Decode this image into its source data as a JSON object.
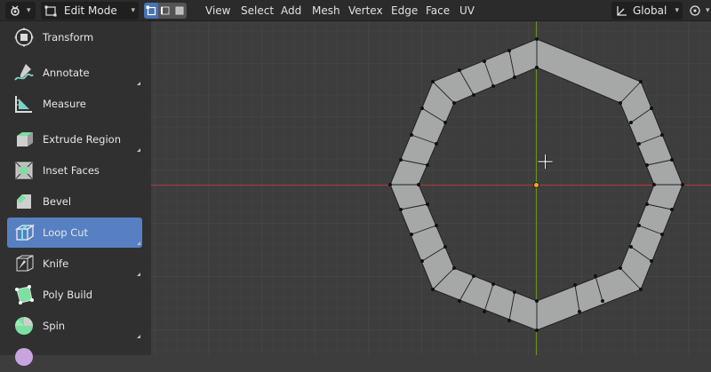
{
  "header": {
    "editor_type_icon": "editor-type-icon",
    "mode_label": "Edit Mode",
    "menus": [
      "View",
      "Select",
      "Add",
      "Mesh",
      "Vertex",
      "Edge",
      "Face",
      "UV"
    ],
    "transform_orientation": "Global"
  },
  "toolbar": {
    "tools": [
      {
        "label": "Transform",
        "icon": "transform-icon"
      },
      {
        "label": "Annotate",
        "icon": "annotate-icon"
      },
      {
        "label": "Measure",
        "icon": "measure-icon"
      },
      {
        "label": "Extrude Region",
        "icon": "extrude-icon"
      },
      {
        "label": "Inset Faces",
        "icon": "inset-icon"
      },
      {
        "label": "Bevel",
        "icon": "bevel-icon"
      },
      {
        "label": "Loop Cut",
        "icon": "loop-cut-icon",
        "active": true
      },
      {
        "label": "Knife",
        "icon": "knife-icon"
      },
      {
        "label": "Poly Build",
        "icon": "poly-build-icon"
      },
      {
        "label": "Spin",
        "icon": "spin-icon"
      }
    ]
  },
  "colors": {
    "active_tool": "#5680c2",
    "x_axis": "#a33a3f",
    "y_axis": "#6c8e23",
    "mesh_face": "#a5a8a7",
    "origin": "#f5a623"
  }
}
